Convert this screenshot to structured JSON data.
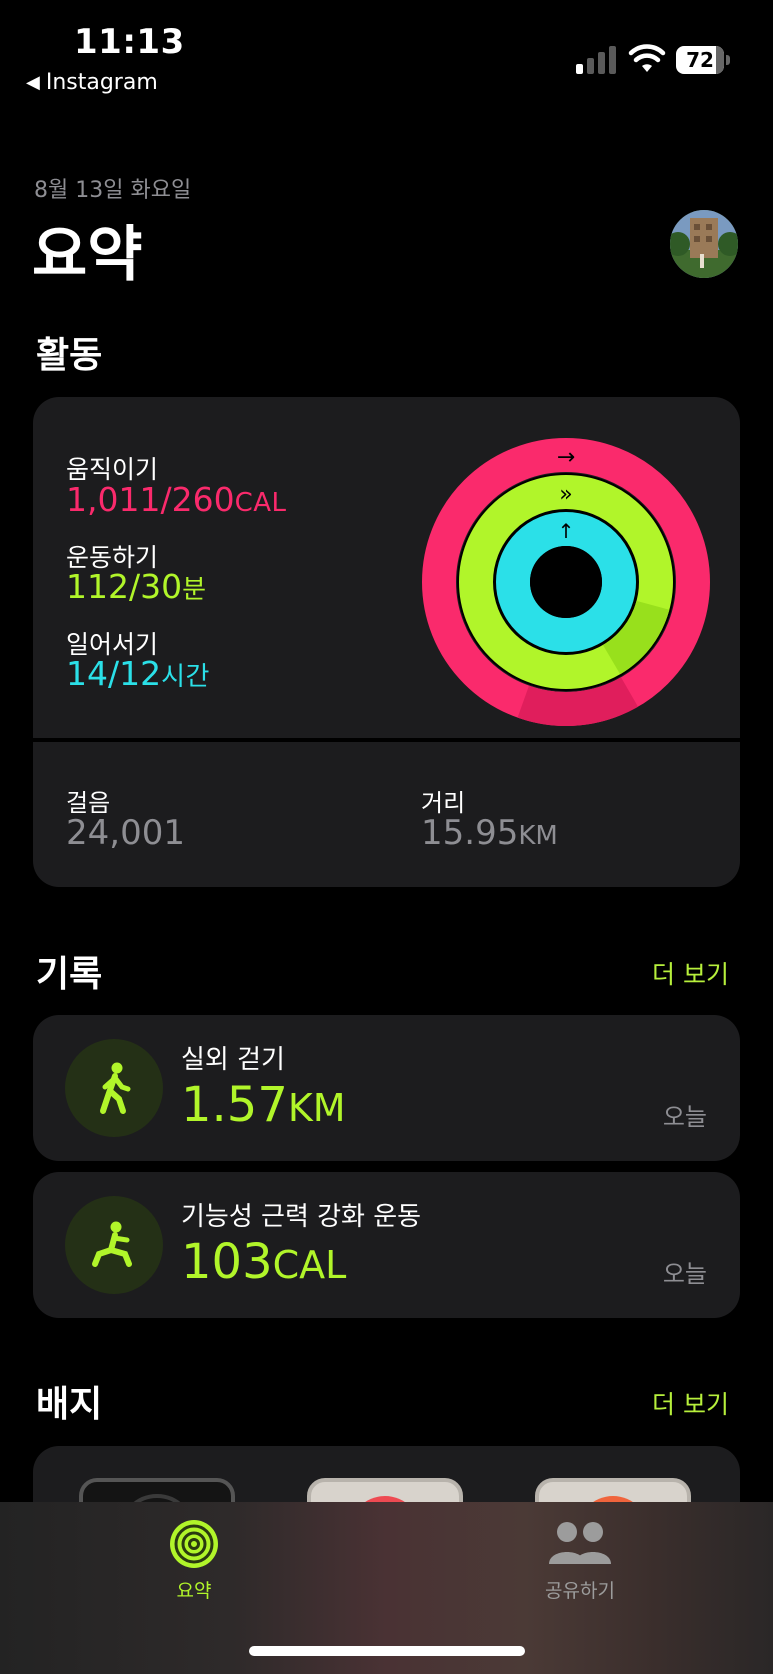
{
  "status_bar": {
    "time": "11:13",
    "back_app": "Instagram",
    "battery": "72"
  },
  "header": {
    "date": "8월 13일 화요일",
    "title": "요약"
  },
  "activity": {
    "section_title": "활동",
    "move": {
      "label": "움직이기",
      "value": "1,011/260",
      "unit": "CAL",
      "color": "#fa2a6c",
      "progress": 3.89
    },
    "exercise": {
      "label": "운동하기",
      "value": "112/30",
      "unit": "분",
      "color": "#b1f52a",
      "progress": 3.73
    },
    "stand": {
      "label": "일어서기",
      "value": "14/12",
      "unit": "시간",
      "color": "#2be0e8",
      "progress": 1.17
    },
    "steps": {
      "label": "걸음",
      "value": "24,001"
    },
    "distance": {
      "label": "거리",
      "value": "15.95",
      "unit": "KM"
    }
  },
  "history": {
    "section_title": "기록",
    "more": "더 보기",
    "workouts": [
      {
        "name": "실외 걷기",
        "value": "1.57",
        "unit": "KM",
        "date": "오늘",
        "icon": "walking-figure-icon"
      },
      {
        "name": "기능성 근력 강화 운동",
        "value": "103",
        "unit": "CAL",
        "date": "오늘",
        "icon": "strength-training-figure-icon"
      }
    ]
  },
  "badges": {
    "section_title": "배지",
    "more": "더 보기"
  },
  "tabs": [
    {
      "label": "요약",
      "icon": "activity-rings-icon",
      "active": true
    },
    {
      "label": "공유하기",
      "icon": "people-icon",
      "active": false
    }
  ]
}
